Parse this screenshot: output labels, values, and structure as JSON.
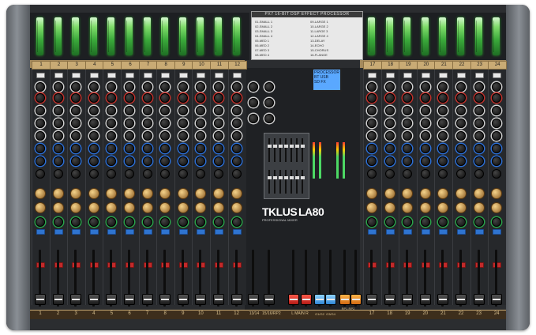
{
  "brand": {
    "logo": "TKLUS",
    "model": "LA80",
    "subtitle": "PROFESSIONAL MIXER"
  },
  "dsp": {
    "title": "PX7 16-BIT DSP EFFECT PROCESSOR",
    "presets": [
      "01-SMALL 1",
      "02-SMALL 2",
      "03-SMALL 3",
      "04-SMALL 4",
      "05-MED 1",
      "06-MED 2",
      "07-MED 3",
      "08-MED 4",
      "09-LARGE 1",
      "10-LARGE 2",
      "11-LARGE 3",
      "12-LARGE 4",
      "13-DELAY",
      "14-ECHO",
      "15-CHORUS",
      "16-FLANGE"
    ]
  },
  "channels": {
    "left": [
      "1",
      "2",
      "3",
      "4",
      "5",
      "6",
      "7",
      "8",
      "9",
      "10",
      "11",
      "12"
    ],
    "right": [
      "17",
      "18",
      "19",
      "20",
      "21",
      "22",
      "23",
      "24"
    ],
    "stereo_left": [
      "13/14",
      "15/16/RP2"
    ],
    "master_labels": [
      "L MAIN R",
      "G1/G2",
      "G3/G4"
    ],
    "return_label": "RP1   RP2"
  },
  "colors": {
    "panel": "#2b2d30",
    "side_rails": "#8a8f95",
    "channel_numbers": "#c9ab75",
    "meter_led": "#7fdc6a",
    "lcd": "#5aa8ff",
    "master_fader": "#ff5a4a",
    "group_fader": "#8fd3ff",
    "return_fader": "#ffb54a"
  }
}
